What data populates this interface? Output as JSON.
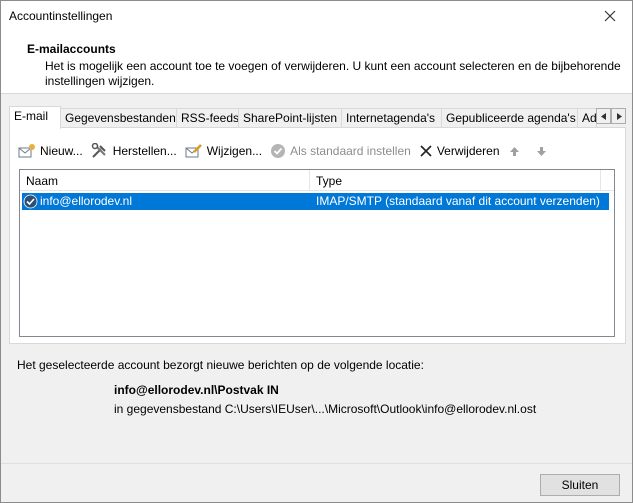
{
  "window": {
    "title": "Accountinstellingen"
  },
  "header": {
    "title": "E-mailaccounts",
    "description": "Het is mogelijk een account toe te voegen of verwijderen. U kunt een account selecteren en de bijbehorende instellingen wijzigen."
  },
  "tabs": [
    {
      "label": "E-mail",
      "active": true
    },
    {
      "label": "Gegevensbestanden"
    },
    {
      "label": "RSS-feeds"
    },
    {
      "label": "SharePoint-lijsten"
    },
    {
      "label": "Internetagenda's"
    },
    {
      "label": "Gepubliceerde agenda's"
    },
    {
      "label": "Ad"
    }
  ],
  "toolbar": {
    "new_label": "Nieuw...",
    "repair_label": "Herstellen...",
    "change_label": "Wijzigen...",
    "default_label": "Als standaard instellen",
    "remove_label": "Verwijderen"
  },
  "list": {
    "columns": [
      "Naam",
      "Type"
    ],
    "rows": [
      {
        "name": "info@ellorodev.nl",
        "type": "IMAP/SMTP (standaard vanaf dit account verzenden)"
      }
    ]
  },
  "location": {
    "intro": "Het geselecteerde account bezorgt nieuwe berichten op de volgende locatie:",
    "folder": "info@ellorodev.nl\\Postvak IN",
    "path": "in gegevensbestand C:\\Users\\IEUser\\...\\Microsoft\\Outlook\\info@ellorodev.nl.ost"
  },
  "footer": {
    "close_label": "Sluiten"
  },
  "colors": {
    "selection": "#0078d7",
    "window_bg": "#f0f0f0"
  }
}
